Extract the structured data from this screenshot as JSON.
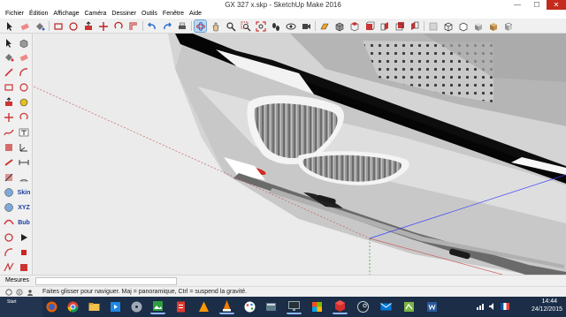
{
  "window": {
    "title": "GX 327 x.skp - SketchUp Make 2016",
    "minimize_glyph": "—",
    "maximize_glyph": "☐",
    "close_glyph": "✕"
  },
  "menu": [
    "Fichier",
    "Édition",
    "Affichage",
    "Caméra",
    "Dessiner",
    "Outils",
    "Fenêtre",
    "Aide"
  ],
  "left_tool_text": {
    "skin": "Skin",
    "xyz": "XYZ",
    "bub": "Bub"
  },
  "measurements": {
    "label": "Mesures",
    "value": ""
  },
  "status": {
    "hint": "Faites glisser pour naviguer. Maj = panoramique, Ctrl =  suspend la gravité."
  },
  "taskbar": {
    "start_label": "Start",
    "clock_time": "14:44",
    "clock_date": "24/12/2015"
  },
  "colors": {
    "accent_red": "#c42b1c",
    "taskbar": "#1b2d47",
    "axis_red": "#c86464",
    "axis_blue": "#3a3aff"
  },
  "icons": {
    "toolbar": [
      "select-arrow",
      "eraser",
      "paint-bucket",
      "rectangle",
      "circle",
      "pushpull",
      "move",
      "rotate",
      "offset",
      "undo",
      "redo",
      "print",
      "orbit",
      "pan",
      "zoom",
      "zoom-window",
      "zoom-extents",
      "walk",
      "look-around",
      "position-camera",
      "section",
      "iso-view",
      "top-view",
      "front-view",
      "right-view",
      "back-view",
      "left-view",
      "xray",
      "wireframe",
      "hidden-line",
      "shaded",
      "textured",
      "monochrome"
    ],
    "taskbar": [
      "firefox",
      "chrome",
      "explorer",
      "windows-media",
      "dvd",
      "photos",
      "vlc",
      "app-pdf",
      "winamp",
      "paint",
      "vlc-alt",
      "tools",
      "desktop",
      "flag",
      "sketchup",
      "steam",
      "mail",
      "greenapp",
      "word",
      "network",
      "sound",
      "flag-fr"
    ]
  }
}
